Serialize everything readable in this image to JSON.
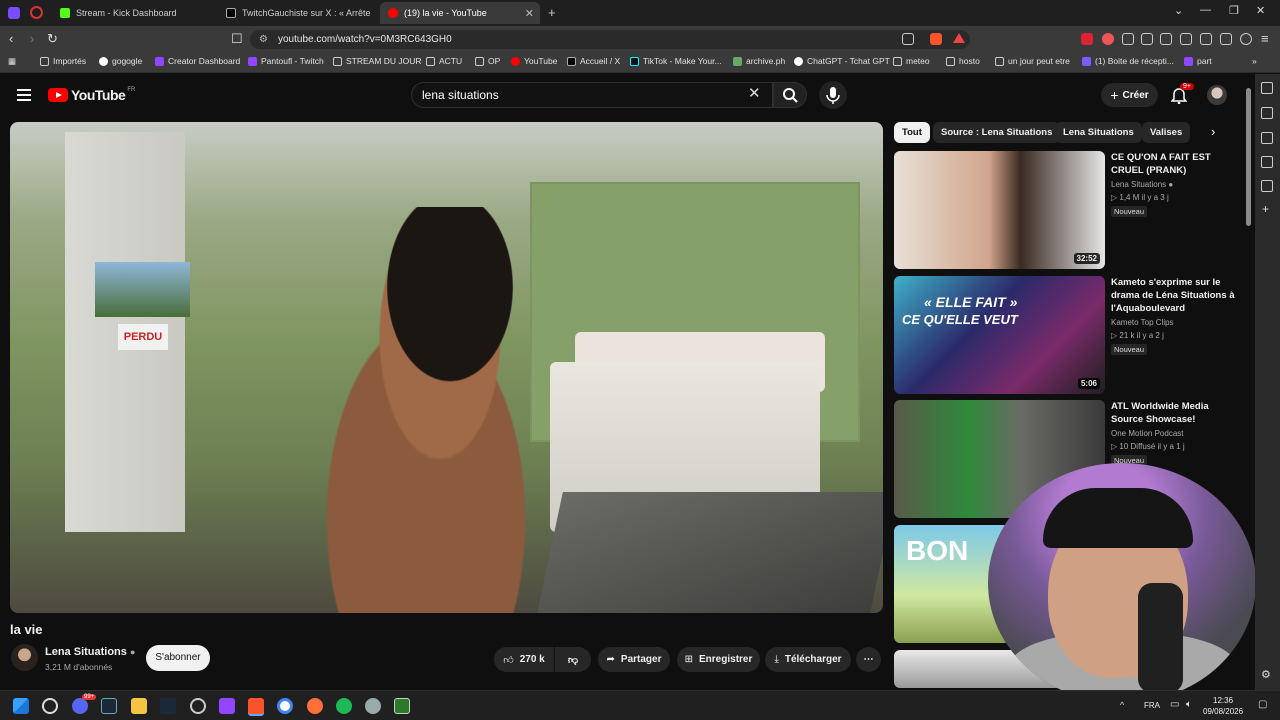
{
  "browser": {
    "tabs": [
      {
        "label": "Stream - Kick Dashboard",
        "color": "#53fc18"
      },
      {
        "label": "TwitchGauchiste sur X : « Arrête",
        "color": "#1d9bf0"
      },
      {
        "label": "(19) la vie - YouTube",
        "color": "#ff0000"
      }
    ],
    "url": "youtube.com/watch?v=0M3RC643GH0",
    "bookmarks": [
      "Importés",
      "gogogle",
      "Creator Dashboard",
      "Pantoufl - Twitch",
      "STREAM DU JOUR",
      "ACTU",
      "OP",
      "YouTube",
      "Accueil / X",
      "TikTok - Make Your...",
      "archive.ph",
      "ChatGPT - Tchat GPT",
      "meteo",
      "hosto",
      "un jour peut etre",
      "(1) Boite de récepti...",
      "part"
    ]
  },
  "youtube": {
    "logo_text": "YouTube",
    "logo_region": "FR",
    "search_value": "lena situations",
    "create_label": "Créer",
    "notif_count": "9+",
    "chips": [
      "Tout",
      "Source : Lena Situations",
      "Lena Situations",
      "Valises"
    ],
    "video": {
      "title": "la vie",
      "overlay_sign": "PERDU",
      "channel": "Lena Situations",
      "subscribers": "3,21 M d'abonnés",
      "subscribe_label": "S'abonner",
      "likes": "270 k",
      "share_label": "Partager",
      "save_label": "Enregistrer",
      "download_label": "Télécharger"
    },
    "recommendations": [
      {
        "title": "CE QU'ON A FAIT EST CRUEL (PRANK)",
        "channel": "Lena Situations",
        "views": "1,4 M",
        "age": "il y a 3 j",
        "badge": "Nouveau",
        "duration": "32:52"
      },
      {
        "title": "Kameto s'exprime sur le drama de Léna Situations à l'Aquaboulevard",
        "channel": "Kameto Top Clips",
        "views": "21 k",
        "age": "il y a 2 j",
        "badge": "Nouveau",
        "duration": "5:06",
        "thumb_text1": "« ELLE FAIT »",
        "thumb_text2": "CE QU'ELLE VEUT"
      },
      {
        "title": "ATL Worldwide Media Source Showcase!",
        "channel": "One Motion Podcast",
        "views": "10",
        "age": "Diffusé il y a 1 j",
        "badge": "Nouveau",
        "duration": ""
      },
      {
        "title": "",
        "thumb_text": "BON"
      }
    ]
  },
  "taskbar": {
    "lang": "FRA",
    "time": "12:36",
    "date": "09/08/2026",
    "discord_badge": "99+"
  },
  "colors": {
    "accent": "#ff0000",
    "bg": "#0f0f0f",
    "chip": "#272727"
  }
}
